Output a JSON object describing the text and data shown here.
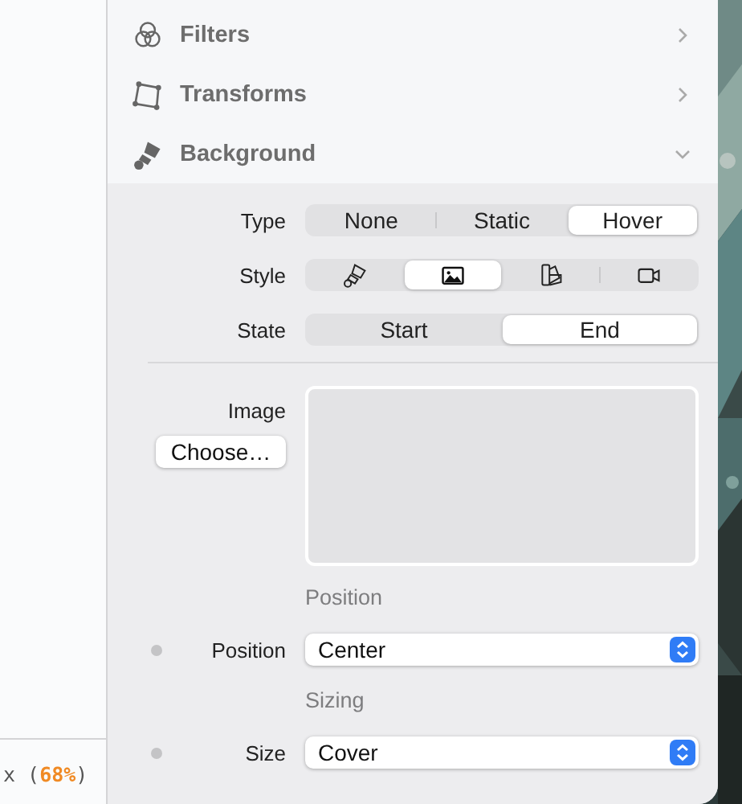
{
  "sidebar": {
    "status": [
      {
        "kind": "plain",
        "text": "x ("
      },
      {
        "kind": "accent",
        "text": "68%"
      },
      {
        "kind": "plain",
        "text": ")"
      }
    ]
  },
  "sections": [
    {
      "title": "Filters",
      "expanded": false
    },
    {
      "title": "Transforms",
      "expanded": false
    },
    {
      "title": "Background",
      "expanded": true
    }
  ],
  "background": {
    "type": {
      "label": "Type",
      "options": [
        {
          "label": "None",
          "selected": false
        },
        {
          "label": "Static",
          "selected": false
        },
        {
          "label": "Hover",
          "selected": true
        }
      ]
    },
    "style": {
      "label": "Style",
      "kind": "icons",
      "options": [
        {
          "selected": false
        },
        {
          "selected": true
        },
        {
          "selected": false
        },
        {
          "selected": false
        }
      ]
    },
    "state": {
      "label": "State",
      "options": [
        {
          "label": "Start",
          "selected": false
        },
        {
          "label": "End",
          "selected": true
        }
      ]
    },
    "image": {
      "label": "Image",
      "button": "Choose…"
    },
    "groups": [
      {
        "heading": "Position",
        "rows": [
          {
            "label": "Position",
            "value": "Center"
          }
        ]
      },
      {
        "heading": "Sizing",
        "rows": [
          {
            "label": "Size",
            "value": "Cover"
          }
        ]
      }
    ]
  }
}
